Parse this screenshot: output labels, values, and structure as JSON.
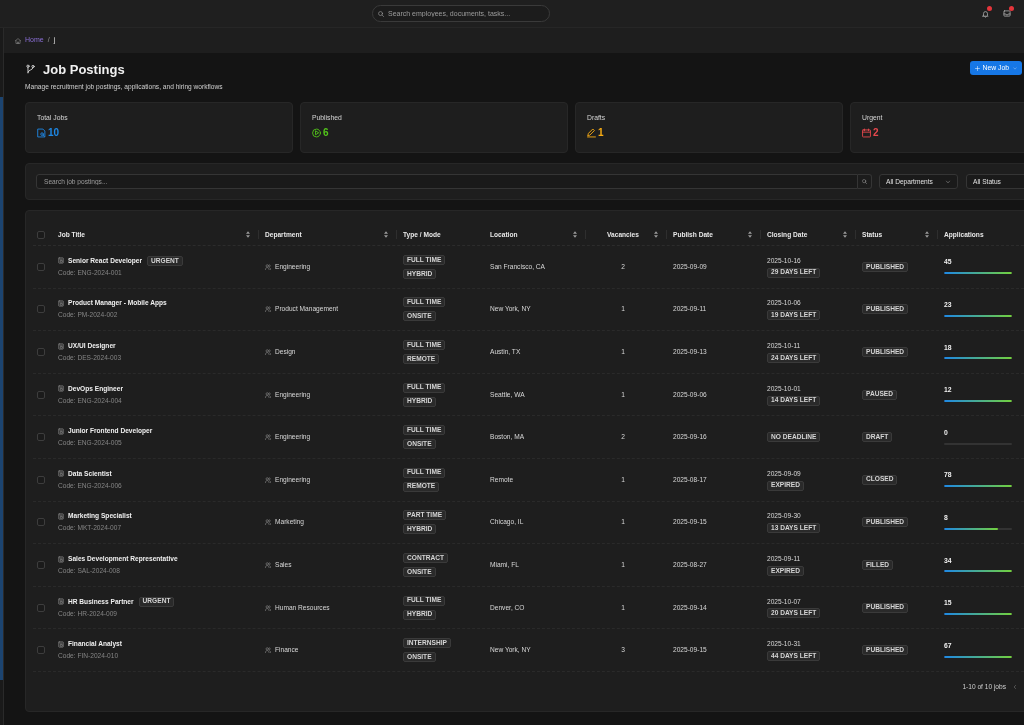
{
  "top_bar": {
    "search": {
      "placeholder": "Search employees, documents, tasks..."
    }
  },
  "breadcrumb": {
    "separator": "/",
    "items": [
      {
        "label": "Home",
        "current": false
      },
      {
        "label": "j",
        "current": true
      }
    ]
  },
  "header": {
    "title": "Job Postings",
    "subtitle": "Manage recruitment job postings, applications, and hiring workflows",
    "new_button": {
      "label": "New Job"
    }
  },
  "stats": [
    {
      "kind": "total",
      "label": "Total Jobs",
      "value": "10",
      "color": "#1e88e5"
    },
    {
      "kind": "published",
      "label": "Published",
      "value": "6",
      "color": "#52c41a"
    },
    {
      "kind": "drafts",
      "label": "Drafts",
      "value": "1",
      "color": "#faad14"
    },
    {
      "kind": "urgent",
      "label": "Urgent",
      "value": "2",
      "color": "#e5484d"
    }
  ],
  "filters": {
    "search": {
      "placeholder": "Search job postings..."
    },
    "selects": [
      {
        "value": "All Departments"
      },
      {
        "value": "All Status"
      }
    ]
  },
  "table": {
    "header_checkbox": {
      "checked": false
    },
    "columns": [
      {
        "label": "Job Title",
        "sortable": true
      },
      {
        "label": "Department",
        "sortable": true
      },
      {
        "label": "Type / Mode",
        "sortable": false
      },
      {
        "label": "Location",
        "sortable": true
      },
      {
        "label": "Vacancies",
        "sortable": true
      },
      {
        "label": "Publish Date",
        "sortable": true
      },
      {
        "label": "Closing Date",
        "sortable": true
      },
      {
        "label": "Status",
        "sortable": true
      },
      {
        "label": "Applications",
        "sortable": false
      }
    ],
    "rows": [
      {
        "checked": false,
        "title": "Senior React Developer",
        "badge": "URGENT",
        "code": "Code: ENG-2024-001",
        "department": "Engineering",
        "type": "FULL TIME",
        "mode": "HYBRID",
        "location": "San Francisco, CA",
        "vacancies": "2",
        "publish_date": "2025-09-09",
        "closing_date": "2025-10-16",
        "deadline": "29 DAYS LEFT",
        "status": "PUBLISHED",
        "applications": "45",
        "level": 1
      },
      {
        "checked": false,
        "title": "Product Manager - Mobile Apps",
        "code": "Code: PM-2024-002",
        "department": "Product Management",
        "type": "FULL TIME",
        "mode": "ONSITE",
        "location": "New York, NY",
        "vacancies": "1",
        "publish_date": "2025-09-11",
        "closing_date": "2025-10-06",
        "deadline": "19 DAYS LEFT",
        "status": "PUBLISHED",
        "applications": "23",
        "level": 1
      },
      {
        "checked": false,
        "title": "UX/UI Designer",
        "code": "Code: DES-2024-003",
        "department": "Design",
        "type": "FULL TIME",
        "mode": "REMOTE",
        "location": "Austin, TX",
        "vacancies": "1",
        "publish_date": "2025-09-13",
        "closing_date": "2025-10-11",
        "deadline": "24 DAYS LEFT",
        "status": "PUBLISHED",
        "applications": "18",
        "level": 1
      },
      {
        "checked": false,
        "title": "DevOps Engineer",
        "code": "Code: ENG-2024-004",
        "department": "Engineering",
        "type": "FULL TIME",
        "mode": "HYBRID",
        "location": "Seattle, WA",
        "vacancies": "1",
        "publish_date": "2025-09-06",
        "closing_date": "2025-10-01",
        "deadline": "14 DAYS LEFT",
        "status": "PAUSED",
        "applications": "12",
        "level": 1
      },
      {
        "checked": false,
        "title": "Junior Frontend Developer",
        "code": "Code: ENG-2024-005",
        "department": "Engineering",
        "type": "FULL TIME",
        "mode": "ONSITE",
        "location": "Boston, MA",
        "vacancies": "2",
        "publish_date": "2025-09-16",
        "deadline": "NO DEADLINE",
        "status": "DRAFT",
        "applications": "0",
        "level": 0
      },
      {
        "checked": false,
        "title": "Data Scientist",
        "code": "Code: ENG-2024-006",
        "department": "Engineering",
        "type": "FULL TIME",
        "mode": "REMOTE",
        "location": "Remote",
        "vacancies": "1",
        "publish_date": "2025-08-17",
        "closing_date": "2025-09-09",
        "deadline": "EXPIRED",
        "status": "CLOSED",
        "applications": "78",
        "level": 1
      },
      {
        "checked": false,
        "title": "Marketing Specialist",
        "code": "Code: MKT-2024-007",
        "department": "Marketing",
        "type": "PART TIME",
        "mode": "HYBRID",
        "location": "Chicago, IL",
        "vacancies": "1",
        "publish_date": "2025-09-15",
        "closing_date": "2025-09-30",
        "deadline": "13 DAYS LEFT",
        "status": "PUBLISHED",
        "applications": "8",
        "level": 0.8
      },
      {
        "checked": false,
        "title": "Sales Development Representative",
        "code": "Code: SAL-2024-008",
        "department": "Sales",
        "type": "CONTRACT",
        "mode": "ONSITE",
        "location": "Miami, FL",
        "vacancies": "1",
        "publish_date": "2025-08-27",
        "closing_date": "2025-09-11",
        "deadline": "EXPIRED",
        "status": "FILLED",
        "applications": "34",
        "level": 1
      },
      {
        "checked": false,
        "title": "HR Business Partner",
        "badge": "URGENT",
        "code": "Code: HR-2024-009",
        "department": "Human Resources",
        "type": "FULL TIME",
        "mode": "HYBRID",
        "location": "Denver, CO",
        "vacancies": "1",
        "publish_date": "2025-09-14",
        "closing_date": "2025-10-07",
        "deadline": "20 DAYS LEFT",
        "status": "PUBLISHED",
        "applications": "15",
        "level": 1
      },
      {
        "checked": false,
        "title": "Financial Analyst",
        "code": "Code: FIN-2024-010",
        "department": "Finance",
        "type": "INTERNSHIP",
        "mode": "ONSITE",
        "location": "New York, NY",
        "vacancies": "3",
        "publish_date": "2025-09-15",
        "closing_date": "2025-10-31",
        "deadline": "44 DAYS LEFT",
        "status": "PUBLISHED",
        "applications": "67",
        "level": 1
      }
    ],
    "pagination": {
      "summary": "1-10 of 10 jobs"
    }
  }
}
